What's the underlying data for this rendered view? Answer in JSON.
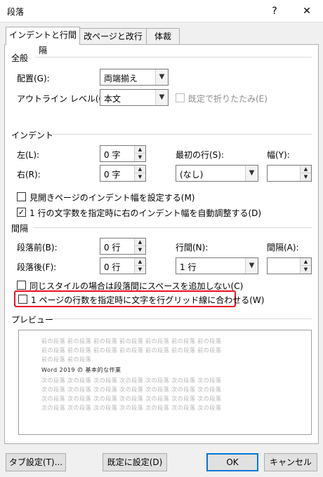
{
  "window": {
    "title": "段落",
    "help": "?",
    "close": "✕"
  },
  "tabs": [
    {
      "label": "インデントと行間隔"
    },
    {
      "label": "改ページと改行"
    },
    {
      "label": "体裁"
    }
  ],
  "general": {
    "heading": "全般",
    "alignment_label": "配置(G):",
    "alignment_value": "両端揃え",
    "outline_label": "アウトライン レベル(O):",
    "outline_value": "本文",
    "collapsed_label": "既定で折りたたみ(E)"
  },
  "indent": {
    "heading": "インデント",
    "left_label": "左(L):",
    "left_value": "0 字",
    "right_label": "右(R):",
    "right_value": "0 字",
    "first_line_label": "最初の行(S):",
    "first_line_value": "(なし)",
    "width_label": "幅(Y):",
    "width_value": "",
    "mirror_label": "見開きページのインデント幅を設定する(M)",
    "auto_adjust_label": "1 行の文字数を指定時に右のインデント幅を自動調整する(D)"
  },
  "spacing": {
    "heading": "間隔",
    "before_label": "段落前(B):",
    "before_value": "0 行",
    "after_label": "段落後(F):",
    "after_value": "0 行",
    "line_spacing_label": "行間(N):",
    "line_spacing_value": "1 行",
    "at_label": "間隔(A):",
    "at_value": "",
    "no_space_label": "同じスタイルの場合は段落間にスペースを追加しない(C)",
    "snap_grid_label": "1 ページの行数を指定時に文字を行グリッド線に合わせる(W)"
  },
  "preview": {
    "heading": "プレビュー",
    "prev_lines": [
      "前の段落 前の段落 前の段落 前の段落 前の段落 前の段落 前の段落",
      "前の段落 前の段落 前の段落 前の段落 前の段落 前の段落 前の段落",
      "前の段落 前の段落"
    ],
    "current": "Word 2019 の 基本的な作業",
    "next_lines": [
      "次の段落 次の段落 次の段落 次の段落 次の段落 次の段落 次の段落",
      "次の段落 次の段落 次の段落 次の段落 次の段落 次の段落 次の段落",
      "次の段落 次の段落 次の段落 次の段落 次の段落 次の段落 次の段落",
      "次の段落 次の段落 次の段落 次の段落 次の段落 次の段落 次の段落"
    ]
  },
  "buttons": {
    "tabs": "タブ設定(T)...",
    "set_default": "既定に設定(D)",
    "ok": "OK",
    "cancel": "キャンセル"
  },
  "states": {
    "mirror_checked": false,
    "auto_adjust_checked": true,
    "no_space_checked": false,
    "snap_grid_checked": false,
    "collapsed_checked": false
  },
  "colors": {
    "highlight": "#e81123",
    "focus": "#0078d7"
  }
}
